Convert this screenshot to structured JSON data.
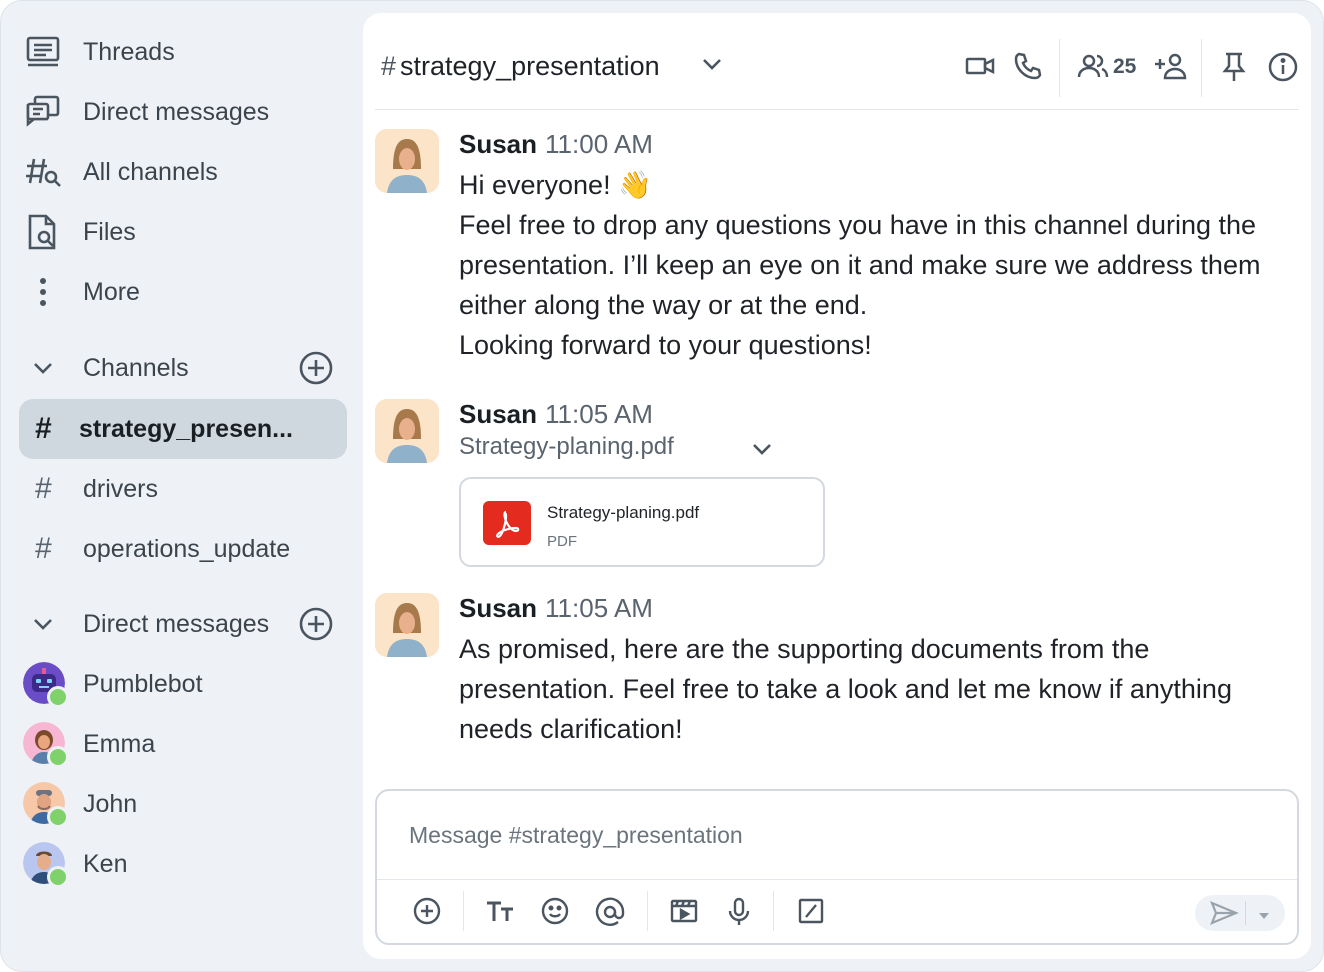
{
  "sidebar": {
    "nav": [
      {
        "label": "Threads",
        "icon": "threads-icon"
      },
      {
        "label": "Direct messages",
        "icon": "direct-messages-icon"
      },
      {
        "label": "All channels",
        "icon": "all-channels-icon"
      },
      {
        "label": "Files",
        "icon": "files-icon"
      },
      {
        "label": "More",
        "icon": "more-vertical-icon"
      }
    ],
    "channels_section": {
      "label": "Channels"
    },
    "channels": [
      {
        "label": "strategy_presen...",
        "active": true
      },
      {
        "label": "drivers",
        "active": false
      },
      {
        "label": "operations_update",
        "active": false
      }
    ],
    "dm_section": {
      "label": "Direct messages"
    },
    "dms": [
      {
        "label": "Pumblebot",
        "status": "online"
      },
      {
        "label": "Emma",
        "status": "online"
      },
      {
        "label": "John",
        "status": "online"
      },
      {
        "label": "Ken",
        "status": "online"
      }
    ]
  },
  "header": {
    "hash": "#",
    "channel_name": "strategy_presentation",
    "member_count": "25"
  },
  "messages": [
    {
      "author": "Susan",
      "time": "11:00 AM",
      "lines": [
        "Hi everyone! 👋",
        "Feel free to drop any questions you have in this channel during the presentation. I’ll keep an eye on it and make sure we address them either along the way or at the end.",
        "Looking forward to your questions!"
      ]
    },
    {
      "author": "Susan",
      "time": "11:05 AM",
      "file_line": "Strategy-planing.pdf",
      "file": {
        "name": "Strategy-planing.pdf",
        "type": "PDF"
      }
    },
    {
      "author": "Susan",
      "time": "11:05 AM",
      "lines": [
        "As promised, here are the supporting documents from the presentation. Feel free to take a look and let me know if anything needs clarification!"
      ]
    }
  ],
  "composer": {
    "placeholder": "Message #strategy_presentation"
  },
  "colors": {
    "sidebar_bg": "#eef2f6",
    "active_channel_bg": "#cfd8df",
    "online_status": "#7fd16a",
    "pdf_red": "#e42b20"
  }
}
